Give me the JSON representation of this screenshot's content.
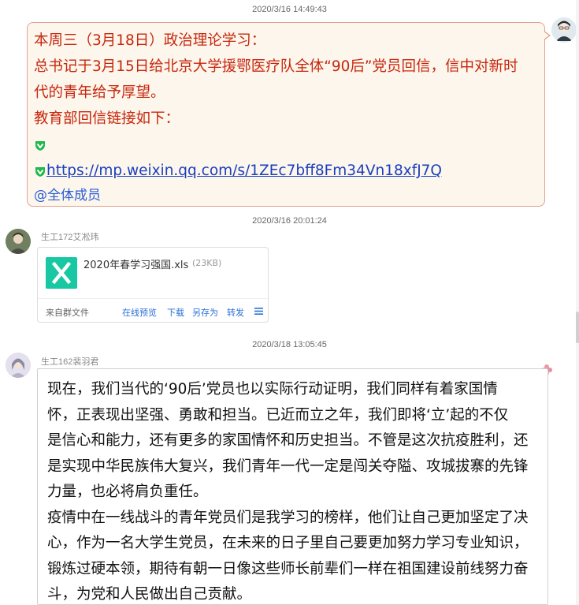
{
  "messages": [
    {
      "timestamp": "2020/3/16 14:49:43",
      "sender": "self",
      "lines": [
        "本周三（3月18日）政治理论学习：",
        "总书记于3月15日给北京大学援鄂医疗队全体“90后”党员回信，信中对新时",
        "代的青年给予厚望。",
        "教育部回信链接如下："
      ],
      "link": "https://mp.weixin.qq.com/s/1ZEc7bff8Fm34Vn18xfJ7Q",
      "mention": "@全体成员"
    },
    {
      "timestamp": "2020/3/16 20:01:24",
      "sender": "生工172艾凇玮",
      "file": {
        "name": "2020年春学习强国.xls",
        "size": "(23KB)",
        "source": "来自群文件",
        "actions": [
          "在线预览",
          "下载",
          "另存为",
          "转发"
        ]
      }
    },
    {
      "timestamp": "2020/3/18 13:05:45",
      "sender": "生工162裴羽君",
      "lines": [
        "现在，我们当代的‘90后’党员也以实际行动证明，我们同样有着家国情",
        "怀，正表现出坚强、勇敢和担当。已近而立之年，我们即将‘立’起的不仅",
        "是信心和能力，还有更多的家国情怀和历史担当。不管是这次抗疫胜利，还",
        "是实现中华民族伟大复兴，我们青年一代一定是闯关夺隘、攻城拔寨的先锋",
        "力量，也必将肩负重任。",
        "疫情中在一线战斗的青年党员们是我学习的榜样，他们让自己更加坚定了决",
        "心，作为一名大学生党员，在未来的日子里自己要更加努力学习专业知识，",
        "锻炼过硬本领，期待有朝一日像这些师长前辈们一样在祖国建设前线努力奋",
        "斗，为党和人民做出自己贡献。"
      ]
    }
  ],
  "colors": {
    "self_text": "#c7270e",
    "self_bubble_bg": "#fdf6ec",
    "self_bubble_border": "#e2a08c",
    "link": "#1a3fbd",
    "file_icon": "#17c8a2",
    "action_link": "#2a6fd6"
  },
  "icons": {
    "link_badge": "green-check-shield-icon",
    "file_type": "excel-file-icon",
    "more": "menu-icon",
    "bubble_decoration": "flower-icon"
  }
}
